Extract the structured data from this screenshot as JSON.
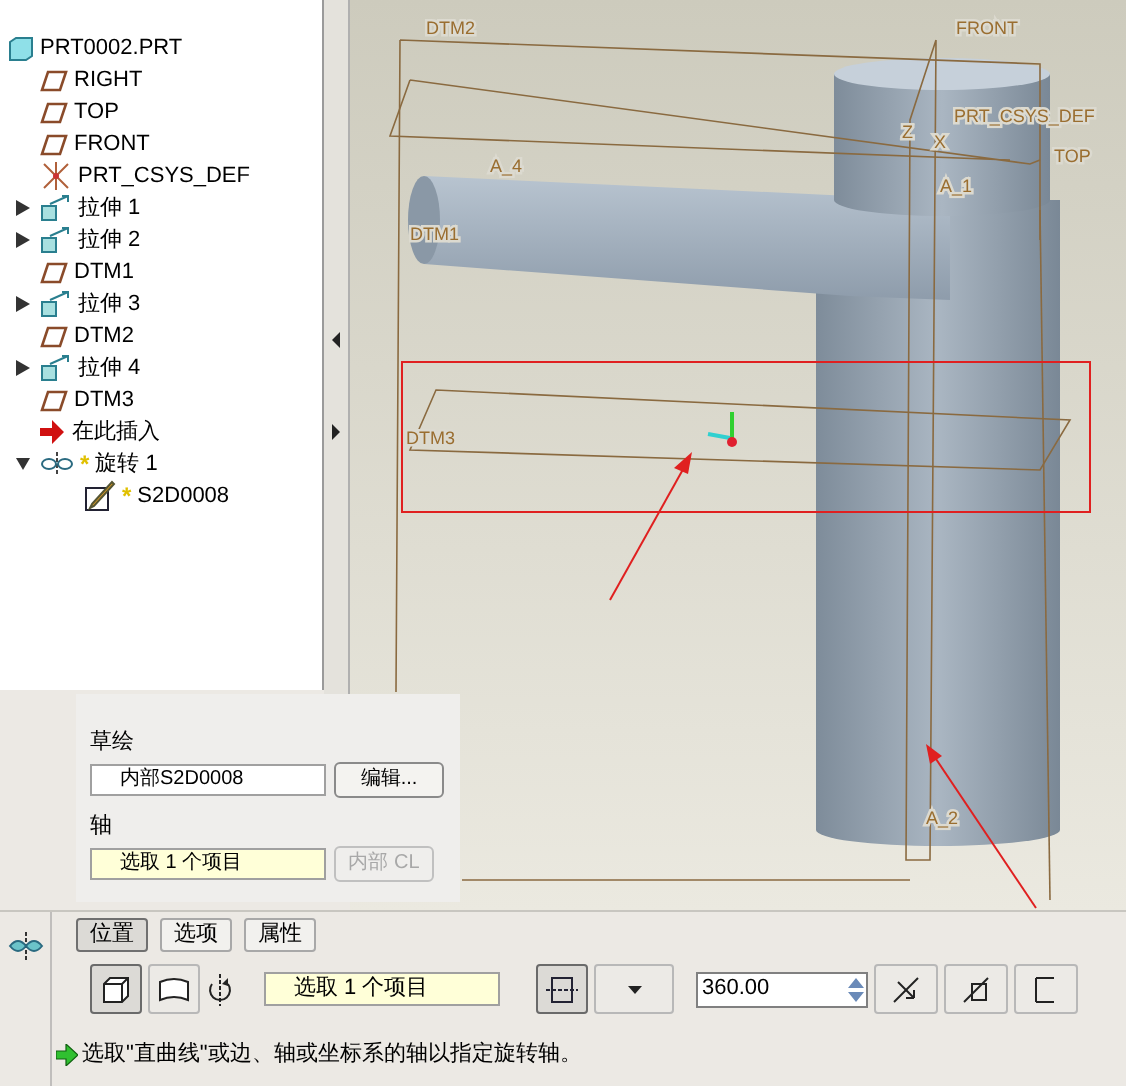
{
  "model_tree": {
    "items": [
      {
        "label": "PRT0002.PRT",
        "kind": "part",
        "children": [
          {
            "label": "RIGHT",
            "kind": "plane"
          },
          {
            "label": "TOP",
            "kind": "plane"
          },
          {
            "label": "FRONT",
            "kind": "plane"
          },
          {
            "label": "PRT_CSYS_DEF",
            "kind": "csys"
          },
          {
            "label": "拉伸 1",
            "kind": "extrude",
            "expanded": false
          },
          {
            "label": "拉伸 2",
            "kind": "extrude",
            "expanded": false
          },
          {
            "label": "DTM1",
            "kind": "plane"
          },
          {
            "label": "拉伸 3",
            "kind": "extrude",
            "expanded": false
          },
          {
            "label": "DTM2",
            "kind": "plane"
          },
          {
            "label": "拉伸 4",
            "kind": "extrude",
            "expanded": false
          },
          {
            "label": "DTM3",
            "kind": "plane"
          },
          {
            "label": "在此插入",
            "kind": "insert"
          },
          {
            "label": "旋转 1",
            "flag": "*",
            "kind": "revolve",
            "expanded": true,
            "children": [
              {
                "label": "S2D0008",
                "flag": "*",
                "kind": "sketch"
              }
            ]
          }
        ]
      }
    ]
  },
  "viewport": {
    "labels": [
      {
        "text": "DTM2"
      },
      {
        "text": "FRONT"
      },
      {
        "text": "PRT_CSYS_DEF"
      },
      {
        "text": "TOP"
      },
      {
        "text": "A_4"
      },
      {
        "text": "A_1"
      },
      {
        "text": "DTM1"
      },
      {
        "text": "DTM3"
      },
      {
        "text": "A_2"
      },
      {
        "text": "Z"
      },
      {
        "text": "X"
      }
    ]
  },
  "placement_panel": {
    "sketch_label": "草绘",
    "sketch_value": "内部S2D0008",
    "edit_button": "编辑...",
    "axis_label": "轴",
    "axis_value": "选取 1 个项目",
    "axis_button": {
      "label": "内部 CL",
      "disabled": true
    }
  },
  "dashboard": {
    "tabs": [
      {
        "label": "位置",
        "selected": true
      },
      {
        "label": "选项",
        "selected": false
      },
      {
        "label": "属性",
        "selected": false
      }
    ],
    "solid_selected": true,
    "surface_selected": false,
    "axis_collector": "选取 1 个项目",
    "axis_mode_selected": true,
    "angle": "360.00",
    "message": "选取\"直曲线\"或边、轴或坐标系的轴以指定旋转轴。"
  }
}
